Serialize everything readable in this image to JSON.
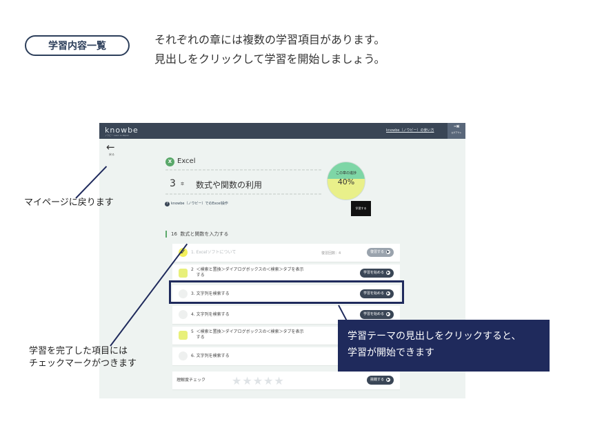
{
  "header_pill": "学習内容一覧",
  "intro": [
    "それぞれの章には複数の学習項目があります。",
    "見出しをクリックして学習を開始しましょう。"
  ],
  "screen": {
    "logo": "knowbe",
    "logo_sub": "ノウビー Learn & Repair",
    "top_link": "knowbe（ノウビー）の使い方",
    "logout_icon": "logout-icon",
    "logout_label": "ログアウト",
    "back_label": "戻る",
    "subject_icon": "excel-icon",
    "subject": "Excel",
    "chapter_number": "3",
    "chapter_mark": "章",
    "chapter_title": "数式や関数の利用",
    "doc_link": "knowbe（ノウビー）でのExcel操作",
    "progress_label": "この章の進捗",
    "progress_value": "40%",
    "progress_fraction": 0.4,
    "dark_button": "学習する",
    "section_number": "16",
    "section_title": "数式と関数を入力する",
    "items": [
      {
        "status": "done",
        "text": "1. Excelソフトについて",
        "meta": "復習回数：4",
        "button": "復習する"
      },
      {
        "status": "partial",
        "num": "2",
        "text": "＜検索と置換＞ダイアログボックスの＜検索＞タブを表示する",
        "button": "学習を始める"
      },
      {
        "status": "none",
        "text": "3. 文字列を検索する",
        "button": "学習を始める"
      },
      {
        "status": "none",
        "text": "4. 文字列を検索する",
        "button": "学習を始める"
      },
      {
        "status": "partial",
        "num": "5",
        "text": "＜検索と置換＞ダイアログボックスの＜検索＞タブを表示する",
        "button": ""
      },
      {
        "status": "none",
        "text": "6. 文字列を検索する",
        "button": ""
      }
    ],
    "quiz": {
      "label": "理解度チェック",
      "stars": "★★★★★",
      "button": "挑戦する"
    }
  },
  "annotations": {
    "mypage": "マイページに戻ります",
    "checkmark": [
      "学習を完了した項目には",
      "チェックマークがつきます"
    ],
    "callout": [
      "学習テーマの見出しをクリックすると、",
      "学習が開始できます"
    ]
  },
  "colors": {
    "navy": "#1f2a5c",
    "topbar": "#3a4656",
    "progress_green": "#7ed6a6",
    "progress_yellow": "#e9f08a"
  }
}
